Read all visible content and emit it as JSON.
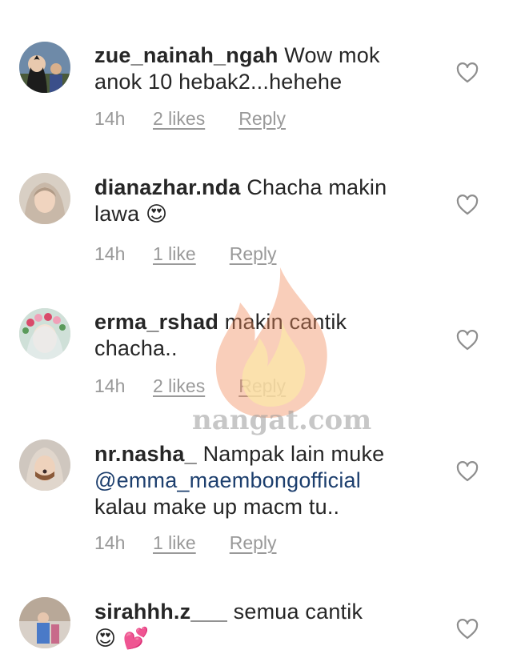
{
  "comments": [
    {
      "username": "zue_nainah_ngah",
      "text_line1": " Wow mok",
      "text_line2": "anok 10 hebak2...hehehe",
      "time": "14h",
      "likes": "2 likes",
      "reply": "Reply"
    },
    {
      "username": "dianazhar.nda",
      "text_line1": " Chacha makin",
      "text_line2": "lawa ",
      "emoji": "😍",
      "time": "14h",
      "likes": "1 like",
      "reply": "Reply"
    },
    {
      "username": "erma_rshad",
      "text_line1": " makin cantik",
      "text_line2": "chacha..",
      "time": "14h",
      "likes": "2 likes",
      "reply": "Reply"
    },
    {
      "username": "nr.nasha_",
      "text_line1": " Nampak lain muke",
      "mention": "@emma_maembongofficial",
      "text_line3": "kalau make up macm tu..",
      "time": "14h",
      "likes": "1 like",
      "reply": "Reply"
    },
    {
      "username": "sirahhh.z___",
      "text_line1": " semua cantik",
      "emoji": "😍 💕"
    }
  ],
  "watermark": {
    "text": "nangat.com"
  },
  "icons": {
    "heart": "heart-outline-icon",
    "flame": "flame-logo"
  },
  "colors": {
    "text": "#262626",
    "meta": "#999999",
    "mention": "#1d3f6e",
    "heart": "#8e8e8e"
  }
}
